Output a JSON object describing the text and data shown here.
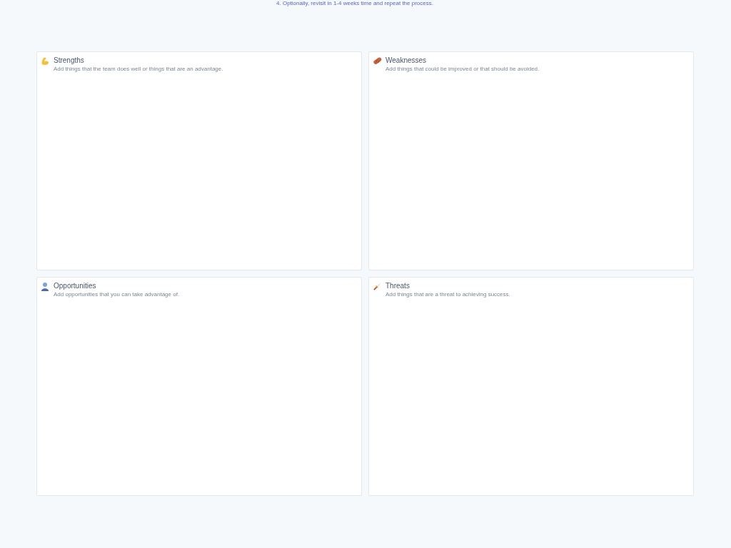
{
  "instructions_tail": "4. Optionally, revisit in 1-4 weeks time and repeat the process.",
  "quadrants": [
    {
      "kind": "strengths",
      "title": "Strengths",
      "description": "Add things that the team does well or things that are an advantage."
    },
    {
      "kind": "weaknesses",
      "title": "Weaknesses",
      "description": "Add things that could be improved or that should be avoided."
    },
    {
      "kind": "opportunities",
      "title": "Opportunities",
      "description": "Add opportunities that you can take advantage of."
    },
    {
      "kind": "threats",
      "title": "Threats",
      "description": "Add things that are a threat to achieving success."
    }
  ]
}
